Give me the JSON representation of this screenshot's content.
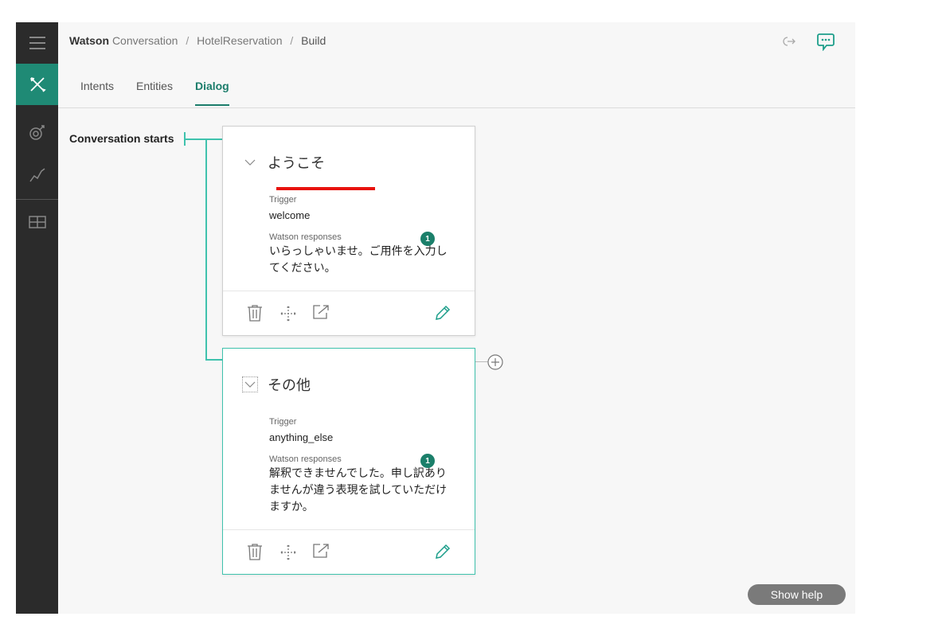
{
  "breadcrumb": {
    "brand": "Watson",
    "service": "Conversation",
    "separator": "/",
    "workspace": "HotelReservation",
    "current": "Build"
  },
  "tabs": [
    {
      "label": "Intents"
    },
    {
      "label": "Entities"
    },
    {
      "label": "Dialog"
    }
  ],
  "active_tab": "Dialog",
  "sidebar": {
    "items": [
      "menu-icon",
      "tools-icon",
      "improve-icon",
      "analytics-icon",
      "deploy-icon"
    ],
    "active": "tools-icon"
  },
  "header_icons": [
    "deploy-arrow-icon",
    "chat-icon"
  ],
  "tree": {
    "start_label": "Conversation starts"
  },
  "nodes": [
    {
      "title": "ようこそ",
      "trigger_label": "Trigger",
      "trigger": "welcome",
      "responses_label": "Watson responses",
      "response_count": "1",
      "response": "いらっしゃいませ。ご用件を入力してください。"
    },
    {
      "title": "その他",
      "trigger_label": "Trigger",
      "trigger": "anything_else",
      "responses_label": "Watson responses",
      "response_count": "1",
      "response": "解釈できませんでした。申し訳ありませんが違う表現を試していただけますか。"
    }
  ],
  "show_help": "Show help",
  "colors": {
    "accent": "#1c7d6b",
    "tree_line": "#3fc2ad",
    "sidebar": "#2b2b2b",
    "annotation": "#e8120c"
  }
}
